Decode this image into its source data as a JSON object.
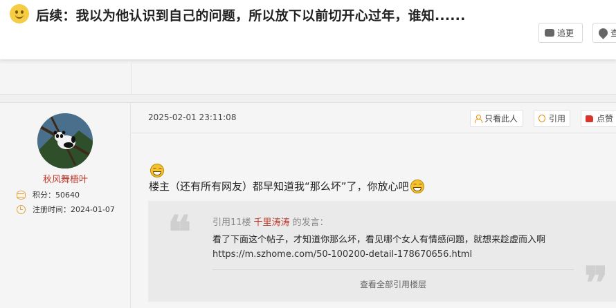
{
  "thread": {
    "title": "后续：我以为他认识到自己的问题，所以放下以前切开心过年，谁知......",
    "actions": {
      "follow": "追更",
      "other": "查"
    }
  },
  "post": {
    "author": {
      "name": "秋风舞梧叶",
      "points_label": "积分：",
      "points": "50640",
      "reg_label": "注册时间：",
      "reg_date": "2024-01-07"
    },
    "time": "2025-02-01 23:11:08",
    "buttons": {
      "only_author": "只看此人",
      "quote": "引用",
      "like": "点赞"
    },
    "content": "楼主（还有所有网友）都早知道我“那么坏”了，你放心吧",
    "quote": {
      "prefix": "引用11楼",
      "author": "千里涛涛",
      "suffix": "的发言：",
      "text": "看了下面这个帖子，才知道你那么坏，看见哪个女人有情感问题，就想来趁虚而入啊",
      "link": "https://m.szhome.com/50-100200-detail-178670656.html",
      "view_all": "查看全部引用楼层"
    }
  },
  "colors": {
    "accent": "#e58a00",
    "username": "#c0392b",
    "link_red": "#c0392b"
  }
}
